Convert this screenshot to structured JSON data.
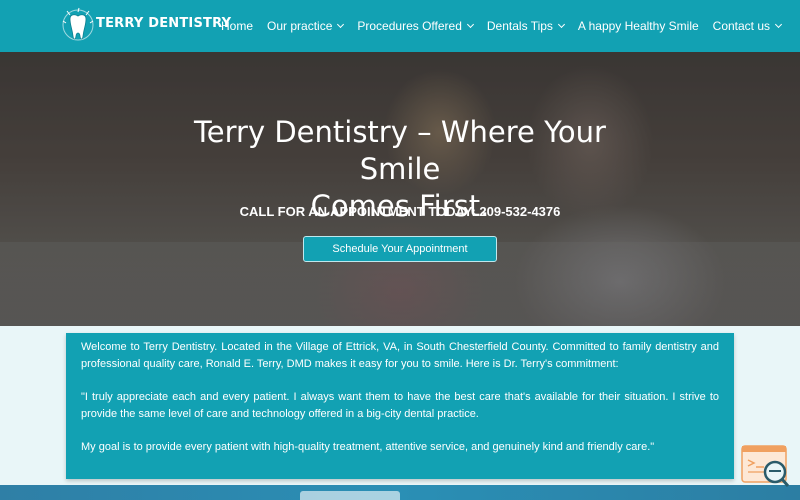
{
  "brand": {
    "name": "TERRY DENTISTRY",
    "logo_icon": "tooth-icon"
  },
  "nav": {
    "items": [
      {
        "label": "Home",
        "has_dropdown": false
      },
      {
        "label": "Our practice",
        "has_dropdown": true
      },
      {
        "label": "Procedures Offered",
        "has_dropdown": true
      },
      {
        "label": "Dentals Tips",
        "has_dropdown": true
      },
      {
        "label": "A happy Healthy Smile",
        "has_dropdown": false
      },
      {
        "label": "Contact us",
        "has_dropdown": true
      }
    ]
  },
  "hero": {
    "title_line1": "Terry Dentistry – Where Your Smile",
    "title_line2": "Comes First.",
    "call_text": "CALL FOR AN APPOINTMENT TODAY: 209-532-4376",
    "cta_label": "Schedule Your Appointment"
  },
  "welcome": {
    "paragraph1": "Welcome to Terry Dentistry. Located in the Village of Ettrick, VA, in South Chesterfield County. Committed to family dentistry and professional quality care, Ronald E. Terry, DMD makes it easy for you to smile. Here is Dr. Terry's commitment:",
    "paragraph2": "\"I truly appreciate each and every patient. I always want them to have the best care that's available for their situation. I strive to provide the same level of care and technology offered in a big-city dental practice.",
    "paragraph3": "My goal is to provide every patient with high-quality treatment, attentive service, and genuinely kind and friendly care.\""
  },
  "colors": {
    "brand_teal": "#12a1b3",
    "widget_orange": "#f0a060"
  },
  "widget": {
    "icon": "chat-search-icon"
  }
}
